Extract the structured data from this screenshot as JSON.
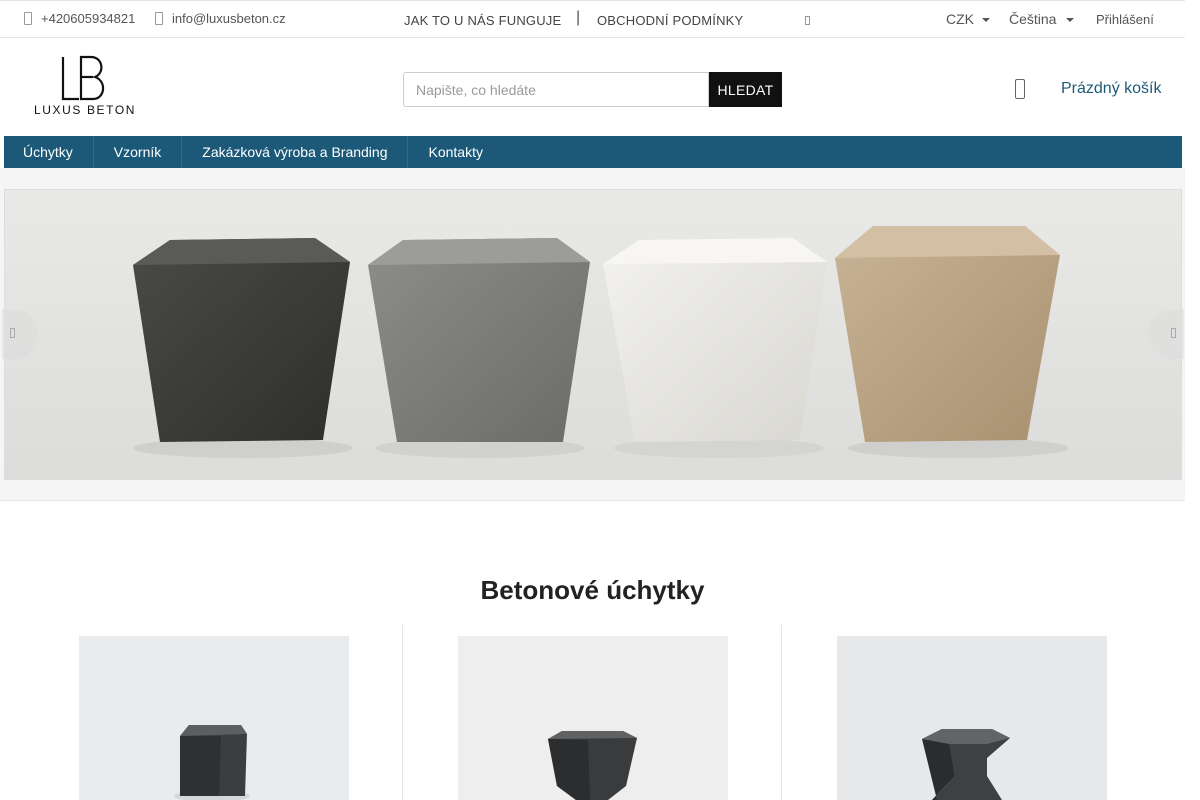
{
  "topbar": {
    "phone": "+420605934821",
    "email": "info@luxusbeton.cz",
    "links": [
      "JAK TO U NÁS FUNGUJE",
      "OBCHODNÍ PODMÍNKY"
    ],
    "separator": "|",
    "currency": "CZK",
    "language": "Čeština",
    "login": "Přihlášení"
  },
  "header": {
    "logo_text": "LUXUS BETON",
    "logo_mark": "LB",
    "search_placeholder": "Napište, co hledáte",
    "search_button": "HLEDAT",
    "cart_label": "Prázdný košík"
  },
  "nav": {
    "items": [
      "Úchytky",
      "Vzorník",
      "Zakázková výroba a Branding",
      "Kontakty"
    ]
  },
  "main": {
    "section_title": "Betonové úchytky"
  },
  "icons": {
    "phone": "phone-icon",
    "email": "envelope-icon",
    "cart": "cart-icon",
    "prev": "chevron-left-icon",
    "next": "chevron-right-icon"
  },
  "colors": {
    "nav_bg": "#1c5978",
    "search_button_bg": "#111111",
    "cart_label": "#1f5a78"
  }
}
